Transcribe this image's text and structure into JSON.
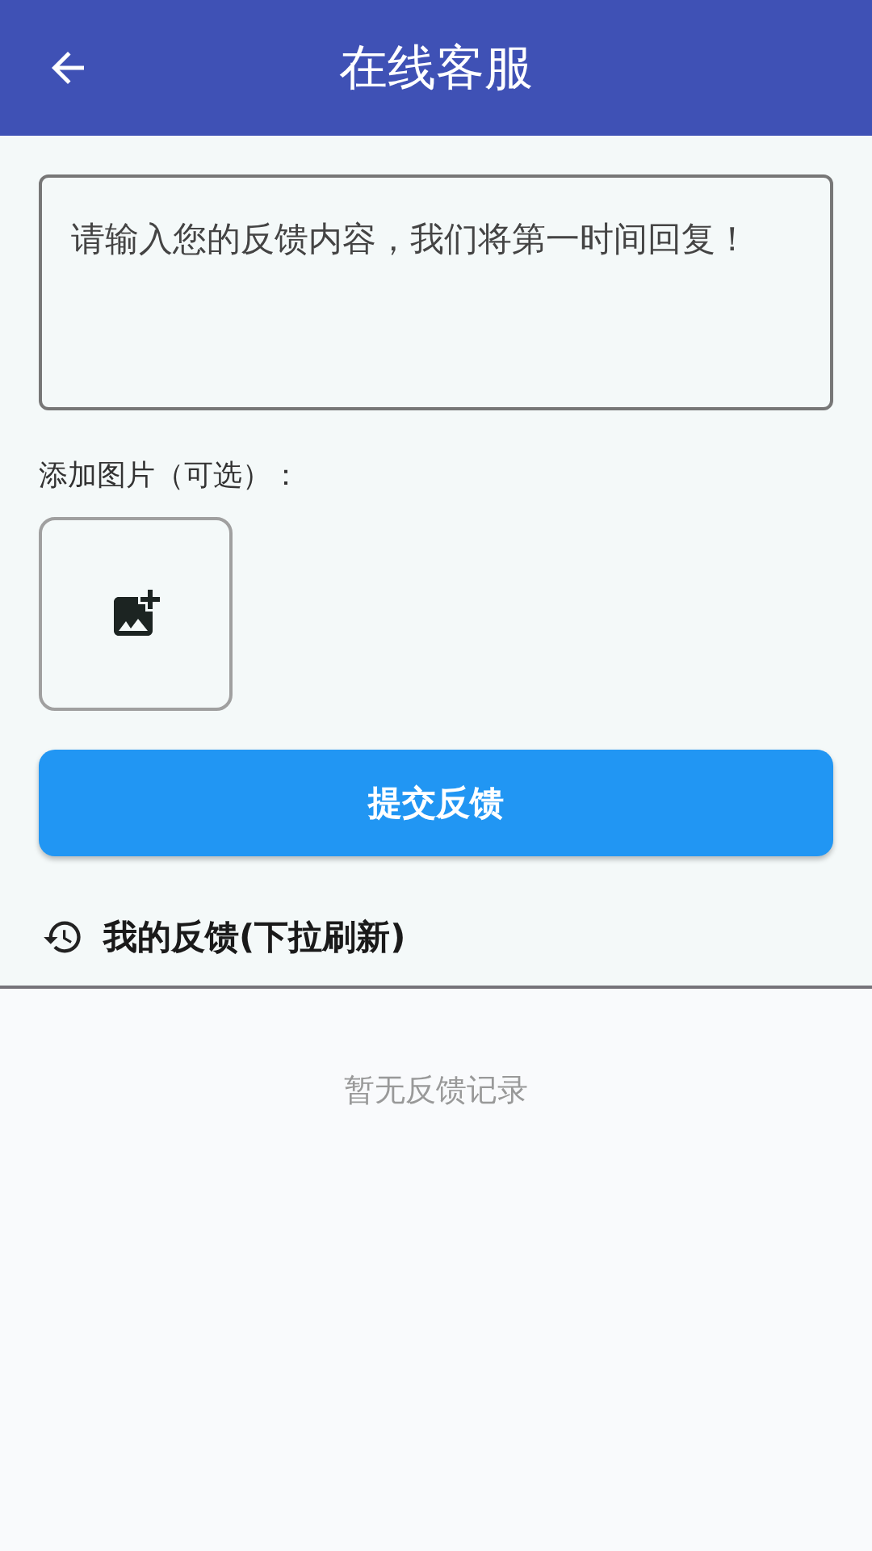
{
  "app_bar": {
    "title": "在线客服"
  },
  "feedback_field": {
    "placeholder": "请输入您的反馈内容，我们将第一时间回复！"
  },
  "image_section": {
    "label": "添加图片（可选）："
  },
  "submit_button": {
    "label": "提交反馈"
  },
  "history": {
    "title": "我的反馈(下拉刷新)",
    "empty_text": "暂无反馈记录"
  }
}
